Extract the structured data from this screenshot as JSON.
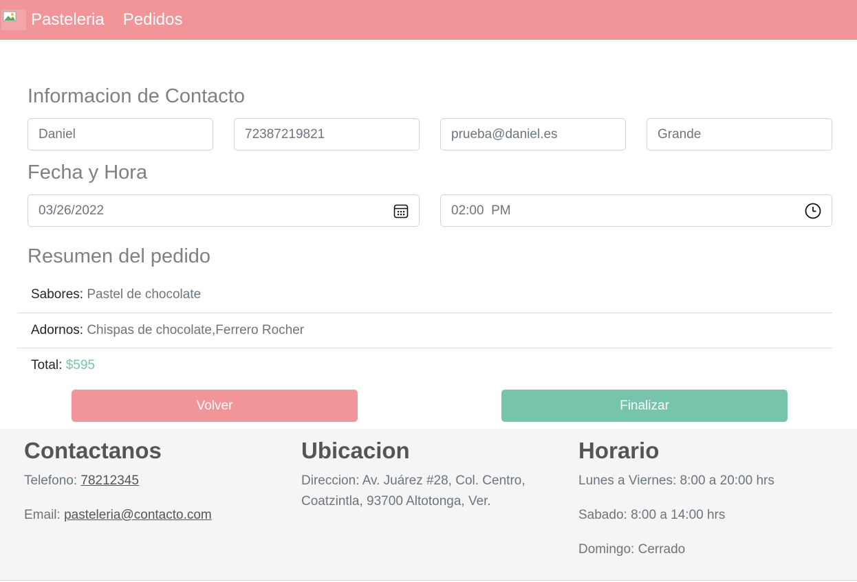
{
  "nav": {
    "brand": "Pasteleria",
    "link": "Pedidos",
    "logo_icon": "broken-image-icon",
    "bg_color": "#f29599"
  },
  "contact": {
    "title": "Informacion de Contacto",
    "name": "Daniel",
    "phone": "72387219821",
    "email": "prueba@daniel.es",
    "size": "Grande"
  },
  "datetime": {
    "title": "Fecha y Hora",
    "date": "03/26/2022",
    "date_icon": "calendar-icon",
    "time": "02:00  PM",
    "time_icon": "clock-icon"
  },
  "summary": {
    "title": "Resumen del pedido",
    "flavors_label": "Sabores:",
    "flavors_value": "Pastel de chocolate",
    "toppings_label": "Adornos:",
    "toppings_value": "Chispas de chocolate,Ferrero Rocher",
    "total_label": "Total:",
    "total_value": "$595",
    "total_color": "#77c4ad"
  },
  "actions": {
    "back_label": "Volver",
    "finish_label": "Finalizar",
    "back_color": "#f29599",
    "finish_color": "#77c4ad"
  },
  "footer": {
    "contact_title": "Contactanos",
    "phone_label": "Telefono:",
    "phone_value": "78212345",
    "email_label": "Email:",
    "email_value": "pasteleria@contacto.com",
    "location_title": "Ubicacion",
    "address_line1": "Direccion: Av. Juárez #28, Col. Centro,",
    "address_line2": "Coatzintla, 93700 Altotonga, Ver.",
    "hours_title": "Horario",
    "weekdays": "Lunes a Viernes: 8:00 a 20:00 hrs",
    "saturday": "Sabado: 8:00 a 14:00 hrs",
    "sunday": "Domingo: Cerrado"
  }
}
